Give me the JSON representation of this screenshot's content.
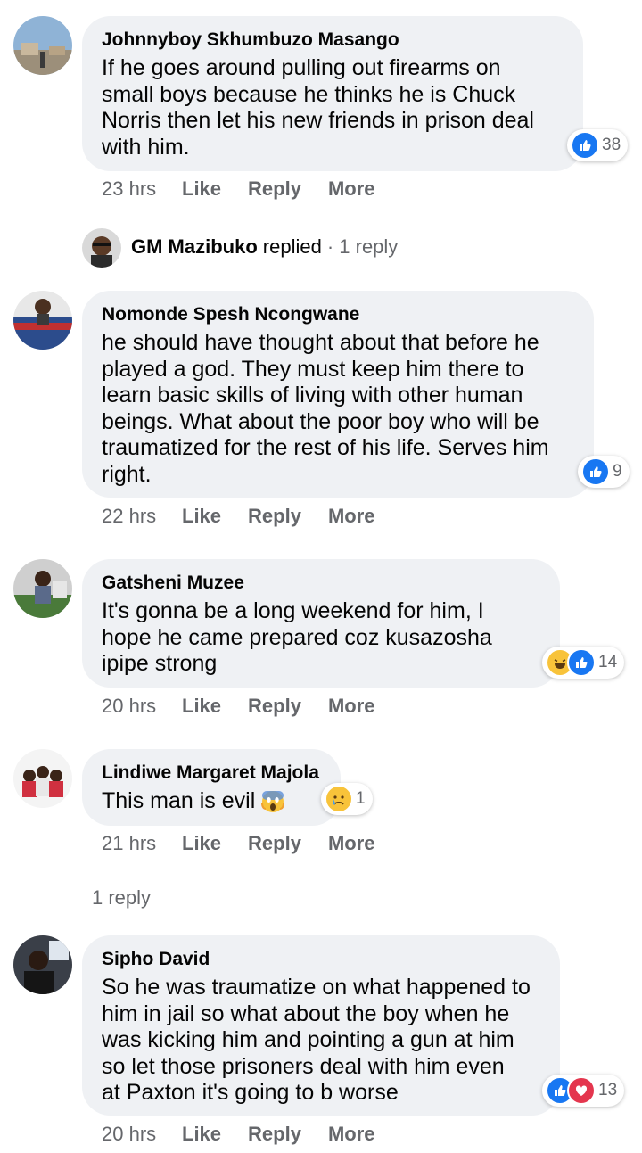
{
  "comments": [
    {
      "author": "Johnnyboy Skhumbuzo Masango",
      "text": "If he goes around pulling out firearms on\nsmall boys because he thinks he is Chuck\nNorris then let his new friends in prison deal\nwith him.",
      "reaction_count": "38",
      "reactions": [
        "like-icon"
      ],
      "time": "23 hrs"
    },
    {
      "author": "Nomonde Spesh Ncongwane",
      "text": "he should have thought about that before he\nplayed a god. They must keep him there to\nlearn basic skills of living with other human\nbeings. What about the poor boy who will be\ntraumatized for the rest of his life. Serves him\nright.",
      "reaction_count": "9",
      "reactions": [
        "like-icon"
      ],
      "time": "22 hrs"
    },
    {
      "author": "Gatsheni Muzee",
      "text": "It's gonna be a long weekend for him, I\nhope he came prepared coz kusazosha\nipipe strong",
      "reaction_count": "14",
      "reactions": [
        "haha-icon",
        "like-icon"
      ],
      "time": "20 hrs"
    },
    {
      "author": "Lindiwe Margaret Majola",
      "text": "This man is evil",
      "inline_emoji": "scream-emoji-icon",
      "reaction_count": "1",
      "reactions": [
        "sad-icon"
      ],
      "time": "21 hrs"
    },
    {
      "author": "Sipho David",
      "text": "So he was traumatize on what happened to\nhim in jail so what about the boy when he\nwas kicking him and pointing a gun at him\nso let those prisoners deal with him even\nat Paxton it's going to b worse",
      "reaction_count": "13",
      "reactions": [
        "like-icon",
        "love-icon"
      ],
      "time": "20 hrs"
    }
  ],
  "actions": {
    "like": "Like",
    "reply": "Reply",
    "more": "More"
  },
  "reply_preview": {
    "name": "GM Mazibuko",
    "verb": "replied",
    "count": "· 1 reply"
  },
  "more_replies": "1 reply",
  "colors": {
    "bubble": "#eff1f4",
    "muted": "#65676b",
    "like": "#1877f2",
    "love": "#e4364e"
  }
}
